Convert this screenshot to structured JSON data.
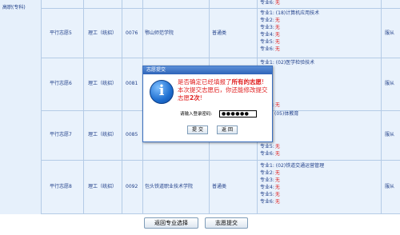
{
  "left_header": "高职(专科)",
  "labels": {
    "major_prefix": "专业",
    "none": "无"
  },
  "rows": [
    {
      "name": "",
      "category": "",
      "code": "",
      "school": "",
      "plan": "",
      "obey": "",
      "majors": [
        {
          "no": "6",
          "value": "无"
        }
      ]
    },
    {
      "name": "平行志愿5",
      "category": "理工（统招）",
      "code": "0076",
      "school": "鄂山师范学院",
      "plan": "普通类",
      "obey": "服从",
      "majors": [
        {
          "no": "1",
          "value": "(18)计算机应用技术"
        },
        {
          "no": "2",
          "value": "无"
        },
        {
          "no": "3",
          "value": "无"
        },
        {
          "no": "4",
          "value": "无"
        },
        {
          "no": "5",
          "value": "无"
        },
        {
          "no": "6",
          "value": "无"
        }
      ]
    },
    {
      "name": "平行志愿6",
      "category": "理工（统招）",
      "code": "0081",
      "school": "",
      "plan": "",
      "obey": "服从",
      "majors": [
        {
          "no": "1",
          "value": "(02)医学检验技术"
        },
        {
          "no": "6",
          "value": "无"
        }
      ]
    },
    {
      "name": "平行志愿7",
      "category": "理工（统招）",
      "code": "0085",
      "school": "",
      "plan": "",
      "obey": "服从",
      "majors": [
        {
          "no": "1",
          "value": "(05)体教育"
        },
        {
          "no": "5",
          "value": "无"
        },
        {
          "no": "6",
          "value": "无"
        }
      ]
    },
    {
      "name": "平行志愿8",
      "category": "理工（统招）",
      "code": "0092",
      "school": "包头铁道职业技术学院",
      "plan": "普通类",
      "obey": "服从",
      "majors": [
        {
          "no": "1",
          "value": "(02)铁道交通运营管理"
        },
        {
          "no": "2",
          "value": "无"
        },
        {
          "no": "3",
          "value": "无"
        },
        {
          "no": "4",
          "value": "无"
        },
        {
          "no": "5",
          "value": "无"
        },
        {
          "no": "6",
          "value": "无"
        }
      ]
    }
  ],
  "buttons": {
    "back": "返回专业选择",
    "submit": "志愿提交"
  },
  "dialog": {
    "title": "志愿提交",
    "msg_a": "是否确定已经填报了",
    "msg_a_bold": "所有的志愿",
    "msg_a_end": "!",
    "msg_b": "本次提交志愿后，你还能修改提交志愿",
    "msg_b_bold": "2次",
    "msg_b_end": "!",
    "password_label": "请输入登录密码:",
    "password_value": "●●●●●●",
    "submit_label": "提 交",
    "return_label": "返 回"
  },
  "colors": {
    "accent": "#2f64b8",
    "warning_text": "#e02020",
    "link_text": "#22418a"
  }
}
